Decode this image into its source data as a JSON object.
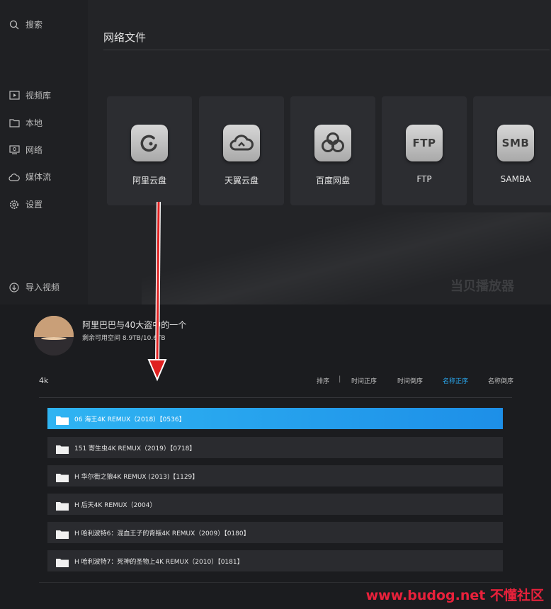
{
  "sidebar": {
    "items": [
      {
        "label": "搜索",
        "icon": "search-icon"
      },
      {
        "label": "视频库",
        "icon": "video-library-icon"
      },
      {
        "label": "本地",
        "icon": "folder-icon"
      },
      {
        "label": "网络",
        "icon": "network-icon"
      },
      {
        "label": "媒体流",
        "icon": "cloud-icon"
      },
      {
        "label": "设置",
        "icon": "gear-icon"
      },
      {
        "label": "导入视频",
        "icon": "import-icon"
      }
    ]
  },
  "main": {
    "title": "网络文件",
    "sources": [
      {
        "label": "阿里云盘",
        "icon": "aliyun-drive-icon"
      },
      {
        "label": "天翼云盘",
        "icon": "tianyi-cloud-icon"
      },
      {
        "label": "百度网盘",
        "icon": "baidu-pan-icon",
        "icon_text": ""
      },
      {
        "label": "FTP",
        "icon": "ftp-icon",
        "icon_text": "FTP"
      },
      {
        "label": "SAMBA",
        "icon": "smb-icon",
        "icon_text": "SMB"
      }
    ],
    "watermark": "当贝播放器"
  },
  "account": {
    "name": "阿里巴巴与40大盗中的一个",
    "space": "剩余可用空间 8.9TB/10.6TB"
  },
  "browser": {
    "folder": "4k",
    "sort": {
      "label": "排序",
      "sep": "|",
      "options": [
        "时间正序",
        "时间倒序",
        "名称正序",
        "名称倒序"
      ],
      "active_index": 2
    },
    "rows": [
      "06 海王4K REMUX（2018）【0536】",
      "151 寄生虫4K REMUX（2019）【0718】",
      "H 华尔街之狼4K REMUX (2013)【1129】",
      "H 后天4K REMUX（2004）",
      "H 哈利波特6：混血王子的背叛4K REMUX（2009）【0180】",
      "H 哈利波特7：死神的圣物上4K REMUX（2010）【0181】"
    ],
    "selected_index": 0
  },
  "brand": {
    "text": "www.budog.net",
    "cn": "不懂社区"
  },
  "colors": {
    "accent": "#2aa8ef",
    "selected_row": "#1d8fe8",
    "arrow": "#e02020",
    "brand": "#e8213b"
  }
}
